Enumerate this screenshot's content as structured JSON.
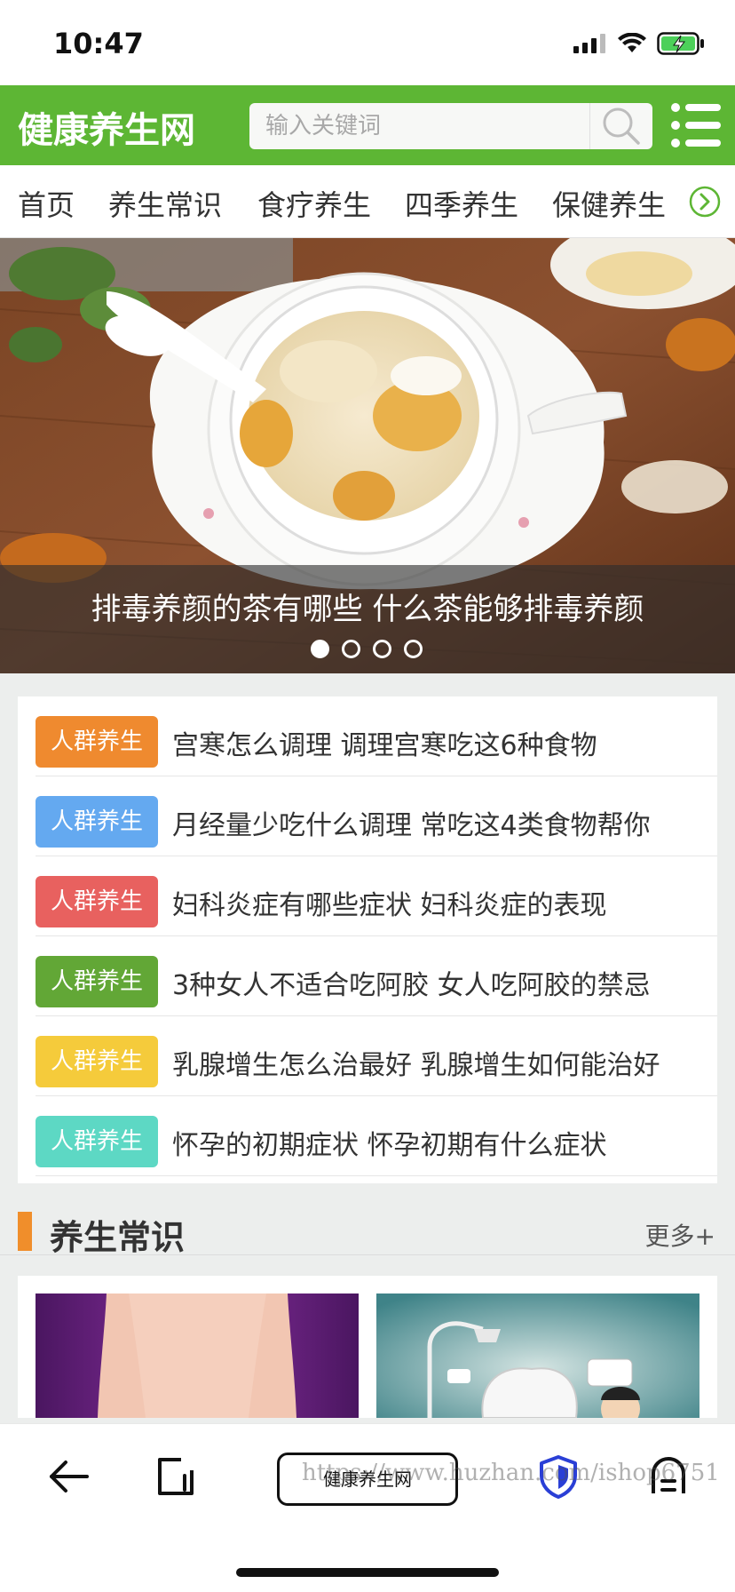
{
  "status_bar": {
    "time": "10:47"
  },
  "header": {
    "logo": "健康养生网",
    "search_placeholder": "输入关键词"
  },
  "nav": {
    "items": [
      "首页",
      "养生常识",
      "食疗养生",
      "四季养生",
      "保健养生"
    ]
  },
  "banner": {
    "title": "排毒养颜的茶有哪些 什么茶能够排毒养颜",
    "slide_count": 4,
    "active_slide": 1
  },
  "articles": [
    {
      "tag": "人群养生",
      "tag_color": "#ef8a2f",
      "title": "宫寒怎么调理 调理宫寒吃这6种食物"
    },
    {
      "tag": "人群养生",
      "tag_color": "#64a9f0",
      "title": "月经量少吃什么调理 常吃这4类食物帮你"
    },
    {
      "tag": "人群养生",
      "tag_color": "#e8615f",
      "title": "妇科炎症有哪些症状 妇科炎症的表现"
    },
    {
      "tag": "人群养生",
      "tag_color": "#62a736",
      "title": "3种女人不适合吃阿胶 女人吃阿胶的禁忌"
    },
    {
      "tag": "人群养生",
      "tag_color": "#f5cb3b",
      "title": "乳腺增生怎么治最好 乳腺增生如何能治好"
    },
    {
      "tag": "人群养生",
      "tag_color": "#5dd8c4",
      "title": "怀孕的初期症状 怀孕初期有什么症状"
    }
  ],
  "section": {
    "title": "养生常识",
    "more": "更多+"
  },
  "browser_bar": {
    "url_label": "健康养生网",
    "watermark": "https://www.huzhan.com/ishop6751"
  },
  "colors": {
    "brand_green": "#5db634",
    "section_accent": "#f08e2b"
  }
}
